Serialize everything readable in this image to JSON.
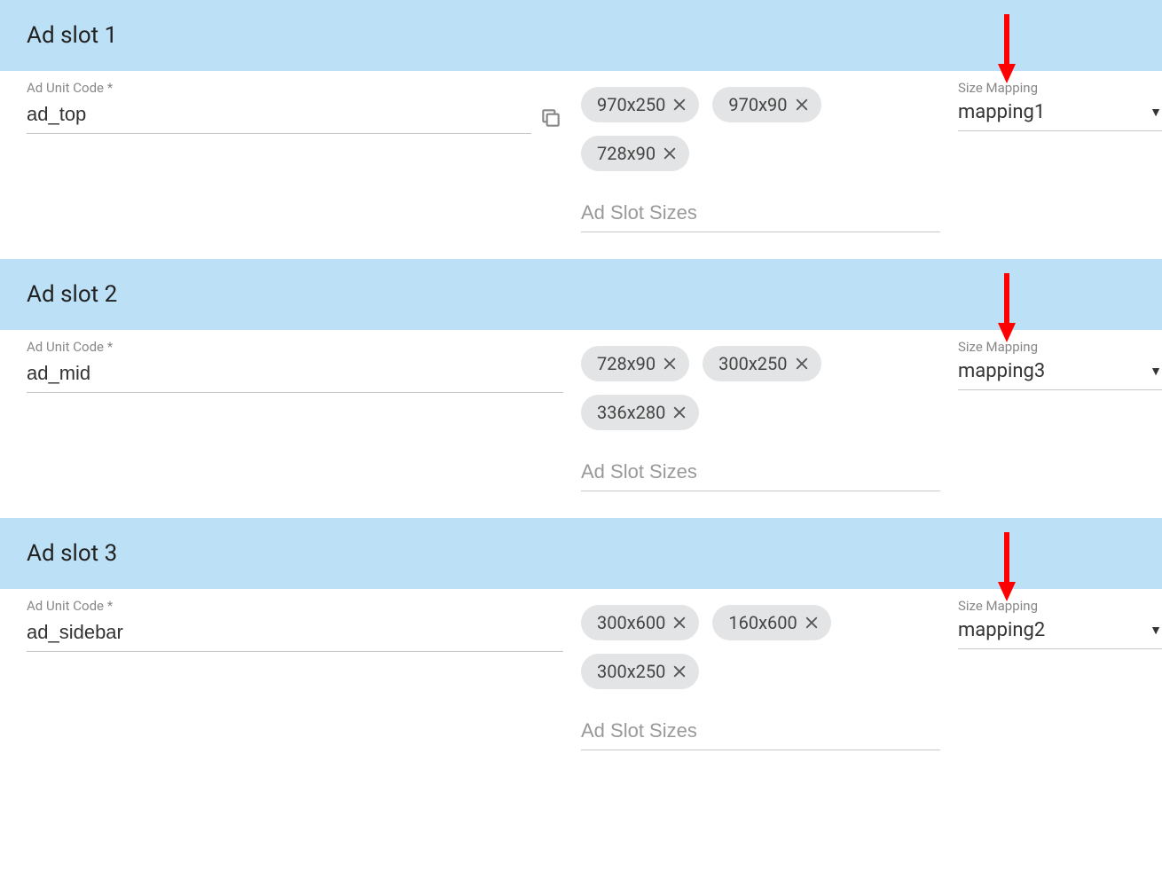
{
  "labels": {
    "ad_unit_code": "Ad Unit Code *",
    "size_mapping": "Size Mapping",
    "ad_slot_sizes_placeholder": "Ad Slot Sizes"
  },
  "slots": [
    {
      "title": "Ad slot 1",
      "ad_unit_code": "ad_top",
      "show_copy": true,
      "sizes": [
        "970x250",
        "970x90",
        "728x90"
      ],
      "size_mapping": "mapping1"
    },
    {
      "title": "Ad slot 2",
      "ad_unit_code": "ad_mid",
      "show_copy": false,
      "sizes": [
        "728x90",
        "300x250",
        "336x280"
      ],
      "size_mapping": "mapping3"
    },
    {
      "title": "Ad slot 3",
      "ad_unit_code": "ad_sidebar",
      "show_copy": false,
      "sizes": [
        "300x600",
        "160x600",
        "300x250"
      ],
      "size_mapping": "mapping2"
    }
  ]
}
